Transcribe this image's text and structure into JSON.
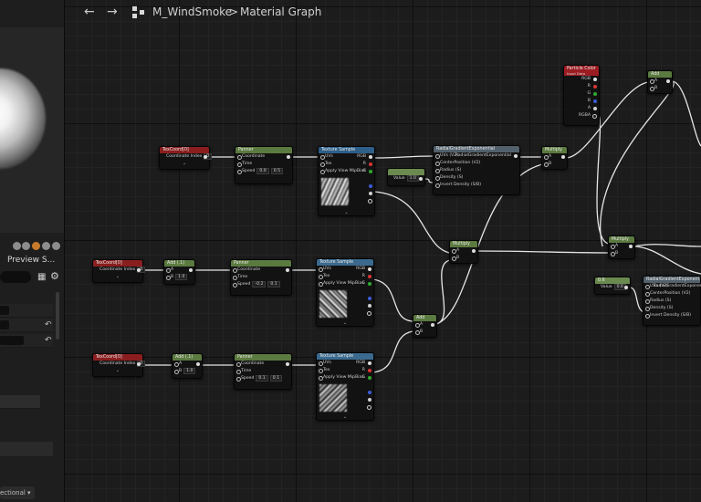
{
  "toolbar": {
    "back_icon": "arrow-left-icon",
    "forward_icon": "arrow-right-icon",
    "breadcrumb_asset": "M_WindSmoke",
    "breadcrumb_separator": ">",
    "breadcrumb_graph": "Material Graph"
  },
  "left_panel": {
    "tab_label": "Preview S...",
    "dropdown_label": "ectional"
  },
  "nodes": {
    "texcoord1": {
      "title": "TexCoord[0]",
      "pin": "Coordinate Index",
      "value": "0"
    },
    "panner1": {
      "title": "Panner",
      "pins": [
        "Coordinate",
        "Time",
        "Speed"
      ],
      "speed_x": "0.0",
      "speed_y": "0.5"
    },
    "texsample1": {
      "title": "Texture Sample",
      "pins": [
        "UVs",
        "Tex",
        "Apply View MipBias"
      ],
      "outs": [
        "RGB",
        "R",
        "G",
        "B",
        "A",
        "RGBA"
      ]
    },
    "radial_gradient1": {
      "title": "RadialGradientExponential",
      "pins": [
        "UVs (V2)",
        "CenterPosition (V2)",
        "Radius (S)",
        "Density (S)",
        "Invert Density (S/B)"
      ],
      "out": "RadialGradientExponential"
    },
    "const_value1": {
      "label": "Value",
      "value": "1.0"
    },
    "multiply_top": {
      "title": "Multiply",
      "a": "A",
      "b": "B"
    },
    "particle_color": {
      "title": "Particle Color",
      "subtitle": "Input Data",
      "outs": [
        "RGB",
        "R",
        "G",
        "B",
        "A",
        "RGBA"
      ]
    },
    "add_top": {
      "title": "Add",
      "a": "A",
      "b": "B"
    },
    "multiply_mid": {
      "title": "Multiply",
      "a": "A",
      "b": "B"
    },
    "multiply_right": {
      "title": "Multiply",
      "a": "A",
      "b": "B"
    },
    "texcoord2": {
      "title": "TexCoord[0]",
      "pin": "Coordinate Index",
      "value": "0"
    },
    "add_small2": {
      "title": "Add (.1)",
      "a": "A",
      "b": "B",
      "b_value": "1.0"
    },
    "panner2": {
      "title": "Panner",
      "pins": [
        "Coordinate",
        "Time",
        "Speed"
      ],
      "speed_x": "-0.2",
      "speed_y": "0.1"
    },
    "texsample2": {
      "title": "Texture Sample",
      "pins": [
        "UVs",
        "Tex",
        "Apply View MipBias"
      ],
      "outs": [
        "RGB",
        "R",
        "G",
        "B",
        "A",
        "RGBA"
      ]
    },
    "add_bottom": {
      "title": "Add",
      "a": "A",
      "b": "B"
    },
    "texcoord3": {
      "title": "TexCoord[0]",
      "pin": "Coordinate Index",
      "value": "0"
    },
    "add_small3": {
      "title": "Add (.1)",
      "a": "A",
      "b": "B",
      "b_value": "1.0"
    },
    "panner3": {
      "title": "Panner",
      "pins": [
        "Coordinate",
        "Time",
        "Speed"
      ],
      "speed_x": "0.1",
      "speed_y": "0.1"
    },
    "texsample3": {
      "title": "Texture Sample",
      "pins": [
        "UVs",
        "Tex",
        "Apply View MipBias"
      ],
      "outs": [
        "RGB",
        "R",
        "G",
        "B",
        "A",
        "RGBA"
      ]
    },
    "const_value2": {
      "title": "0.6",
      "label": "Value",
      "value": "0.6"
    },
    "radial_gradient2": {
      "title": "RadialGradientExponential",
      "pins": [
        "UVs (V2)",
        "CenterPosition (V2)",
        "Radius (S)",
        "Density (S)",
        "Invert Density (S/B)"
      ],
      "out": "RadialGradientExponential"
    }
  },
  "colors": {
    "wire": "#e6e6e6",
    "grid_bg": "#1c1c1c",
    "header_red": "#8a1e1e",
    "header_green": "#5b7a3f",
    "header_blue": "#2d5f88"
  }
}
